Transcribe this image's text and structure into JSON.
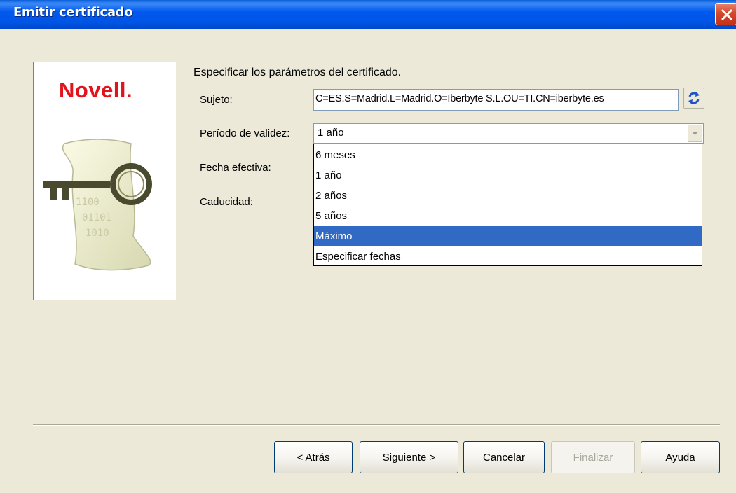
{
  "window": {
    "title": "Emitir certificado"
  },
  "branding": {
    "logo_text": "Novell."
  },
  "form": {
    "heading": "Especificar los parámetros del certificado.",
    "subject_label": "Sujeto:",
    "subject_value": "C=ES.S=Madrid.L=Madrid.O=Iberbyte S.L.OU=TI.CN=iberbyte.es",
    "period_label": "Período de validez:",
    "period_value": "1 año",
    "effective_date_label": "Fecha efectiva:",
    "expiry_label": "Caducidad:"
  },
  "dropdown": {
    "options": [
      "6 meses",
      "1 año",
      "2 años",
      "5 años",
      "Máximo",
      "Especificar fechas"
    ],
    "highlighted": "Máximo"
  },
  "buttons": {
    "back": "< Atrás",
    "next": "Siguiente >",
    "cancel": "Cancelar",
    "finish": "Finalizar",
    "help": "Ayuda"
  },
  "colors": {
    "titlebar": "#0055e5",
    "logo": "#e2131a",
    "selection": "#316ac5",
    "dialog_bg": "#ece9d8"
  },
  "icons": [
    "close-icon",
    "refresh-icon",
    "chevron-down-icon"
  ]
}
